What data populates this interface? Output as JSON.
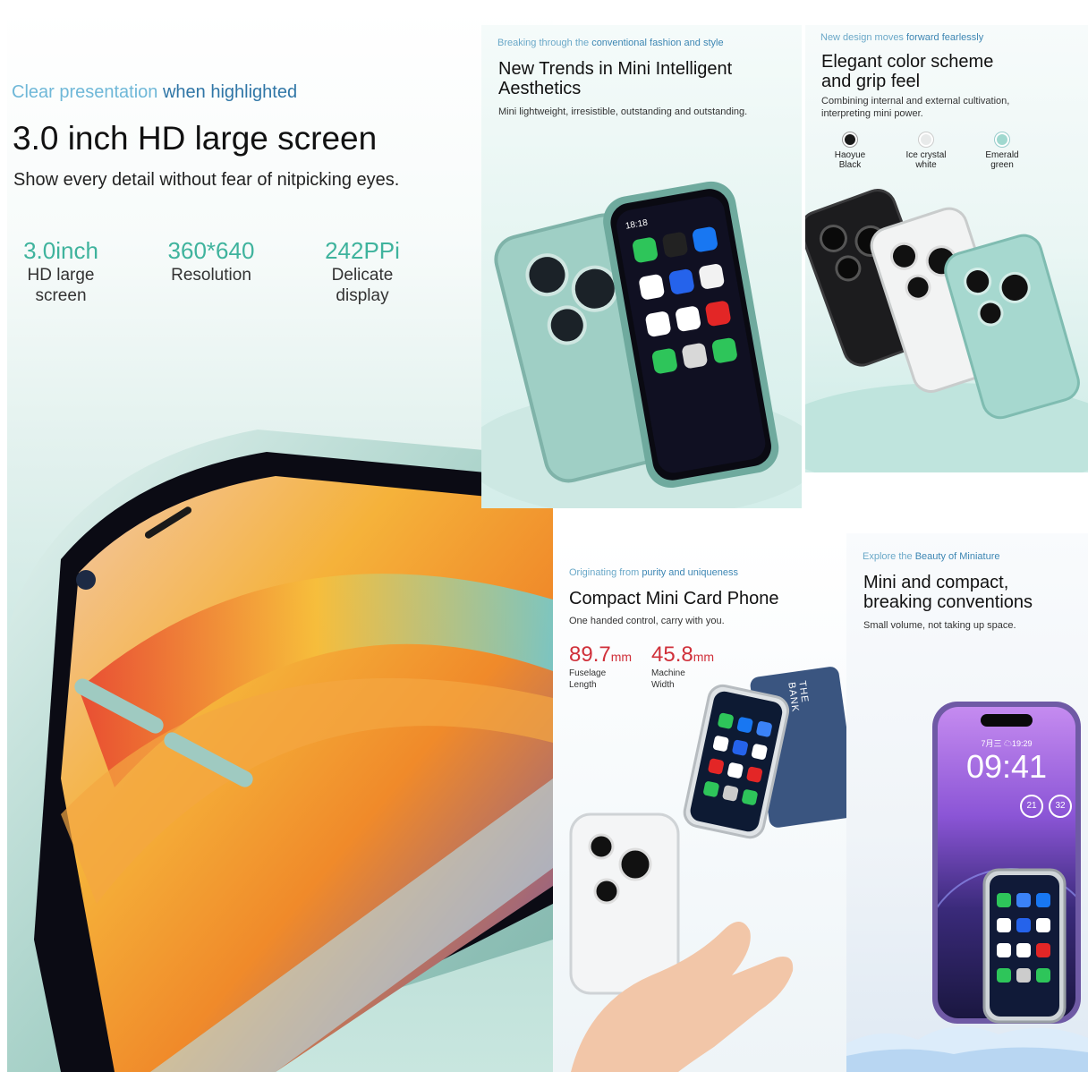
{
  "main": {
    "eyebrow_part1": "Clear presentation ",
    "eyebrow_part2": "when highlighted",
    "title": "3.0 inch HD large screen",
    "subtitle": "Show every detail without fear of nitpicking eyes.",
    "stats": [
      {
        "value": "3.0inch",
        "label_line1": "HD large",
        "label_line2": "screen"
      },
      {
        "value": "360*640",
        "label_line1": "Resolution",
        "label_line2": ""
      },
      {
        "value": "242PPi",
        "label_line1": "Delicate",
        "label_line2": "display"
      }
    ]
  },
  "trends": {
    "eyebrow_part1": "Breaking through the ",
    "eyebrow_part2": "conventional fashion and style",
    "title_line1": "New Trends in Mini Intelligent",
    "title_line2": "Aesthetics",
    "desc": "Mini lightweight, irresistible, outstanding and outstanding.",
    "status_time": "18:18"
  },
  "color": {
    "eyebrow_part1": "New design moves ",
    "eyebrow_part2": "forward fearlessly",
    "title_line1": "Elegant color scheme",
    "title_line2": "and grip feel",
    "desc_line1": "Combining internal and external cultivation,",
    "desc_line2": "interpreting mini power.",
    "swatches": [
      {
        "line1": "Haoyue",
        "line2": "Black",
        "color": "#1a1a1a"
      },
      {
        "line1": "Ice crystal",
        "line2": "white",
        "color": "#e8eaea"
      },
      {
        "line1": "Emerald",
        "line2": "green",
        "color": "#9fd8cf"
      }
    ]
  },
  "compact": {
    "eyebrow_part1": "Originating from ",
    "eyebrow_part2": "purity and uniqueness",
    "title": "Compact Mini Card Phone",
    "desc": "One handed control, carry with you.",
    "dims": [
      {
        "value": "89.7",
        "unit": "mm",
        "line1": "Fuselage",
        "line2": "Length"
      },
      {
        "value": "45.8",
        "unit": "mm",
        "line1": "Machine",
        "line2": "Width"
      }
    ],
    "card_text": "THE BANK",
    "accent": "#d0303a"
  },
  "mini": {
    "eyebrow_part1": "Explore the ",
    "eyebrow_part2": "Beauty of Miniature",
    "title_line1": "Mini and compact,",
    "title_line2": "breaking conventions",
    "desc": "Small volume, not taking up space.",
    "lock_date": "7月三 ☁19:29",
    "lock_time": "09:41",
    "widget1": "21",
    "widget2": "32"
  }
}
